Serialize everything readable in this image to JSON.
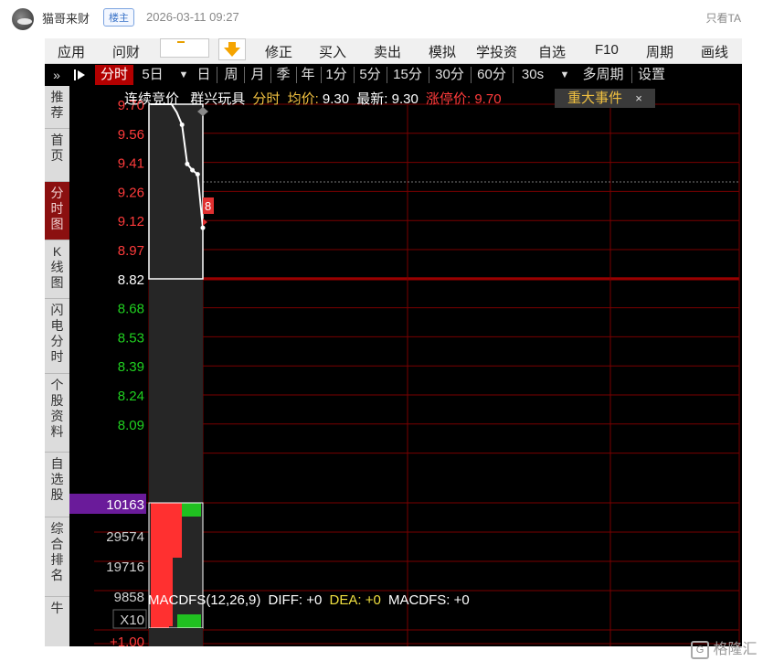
{
  "post": {
    "author": "猫哥来财",
    "op_badge": "楼主",
    "time": "2026-03-11 09:27",
    "only_ta": "只看TA"
  },
  "top_menu": [
    "应用",
    "问财",
    "修正",
    "买入",
    "卖出",
    "模拟",
    "学投资",
    "自选",
    "F10",
    "周期",
    "画线"
  ],
  "tabs": [
    "分时",
    "5日",
    "日",
    "周",
    "月",
    "季",
    "年",
    "1分",
    "5分",
    "15分",
    "30分",
    "60分",
    "30s",
    "多周期",
    "设置"
  ],
  "selected_tab": "分时",
  "sidebar": [
    "推荐",
    "首页",
    "分时图",
    "K线图",
    "闪电分时",
    "个股资料",
    "自选股",
    "综合排名",
    "牛"
  ],
  "selected_sidebar": "分时图",
  "info_bar": {
    "mode": "连续竞价",
    "stock_name": "群兴玩具",
    "view": "分时",
    "avg_label": "均价:",
    "avg_value": "9.30",
    "latest_label": "最新:",
    "latest_value": "9.30",
    "limit_label": "涨停价:",
    "limit_value": "9.70",
    "event_button": "重大事件",
    "close_glyph": "×"
  },
  "price_axis": {
    "labels": [
      "9.70",
      "9.56",
      "9.41",
      "9.26",
      "9.12",
      "8.97",
      "8.82",
      "8.68",
      "8.53",
      "8.39",
      "8.24",
      "8.09"
    ],
    "colors": [
      "red",
      "red",
      "red",
      "red",
      "red",
      "red",
      "white",
      "green",
      "green",
      "green",
      "green",
      "green"
    ]
  },
  "volume_axis": {
    "current": "10163",
    "labels": [
      "29574",
      "19716",
      "9858"
    ],
    "scale": "X10"
  },
  "macd": {
    "name": "MACDFS(12,26,9)",
    "diff_label": "DIFF:",
    "diff_value": "+0",
    "dea_label": "DEA:",
    "dea_value": "+0",
    "macdfs_label": "MACDFS:",
    "macdfs_value": "+0",
    "axis_value": "+1.00"
  },
  "marker_badge": "8",
  "watermark": "格隆汇",
  "chart_data": {
    "type": "line",
    "ylim": [
      8.09,
      9.7
    ],
    "price_series": [
      9.7,
      9.7,
      9.7,
      9.7,
      9.7,
      9.66,
      9.6,
      9.41,
      9.38,
      9.36,
      9.1
    ],
    "colors": {
      "up": "#ff3030",
      "down": "#20c020",
      "grid": "#7a0000",
      "price_line": "#ffffff",
      "volume_current": "#6a1b9a"
    }
  }
}
